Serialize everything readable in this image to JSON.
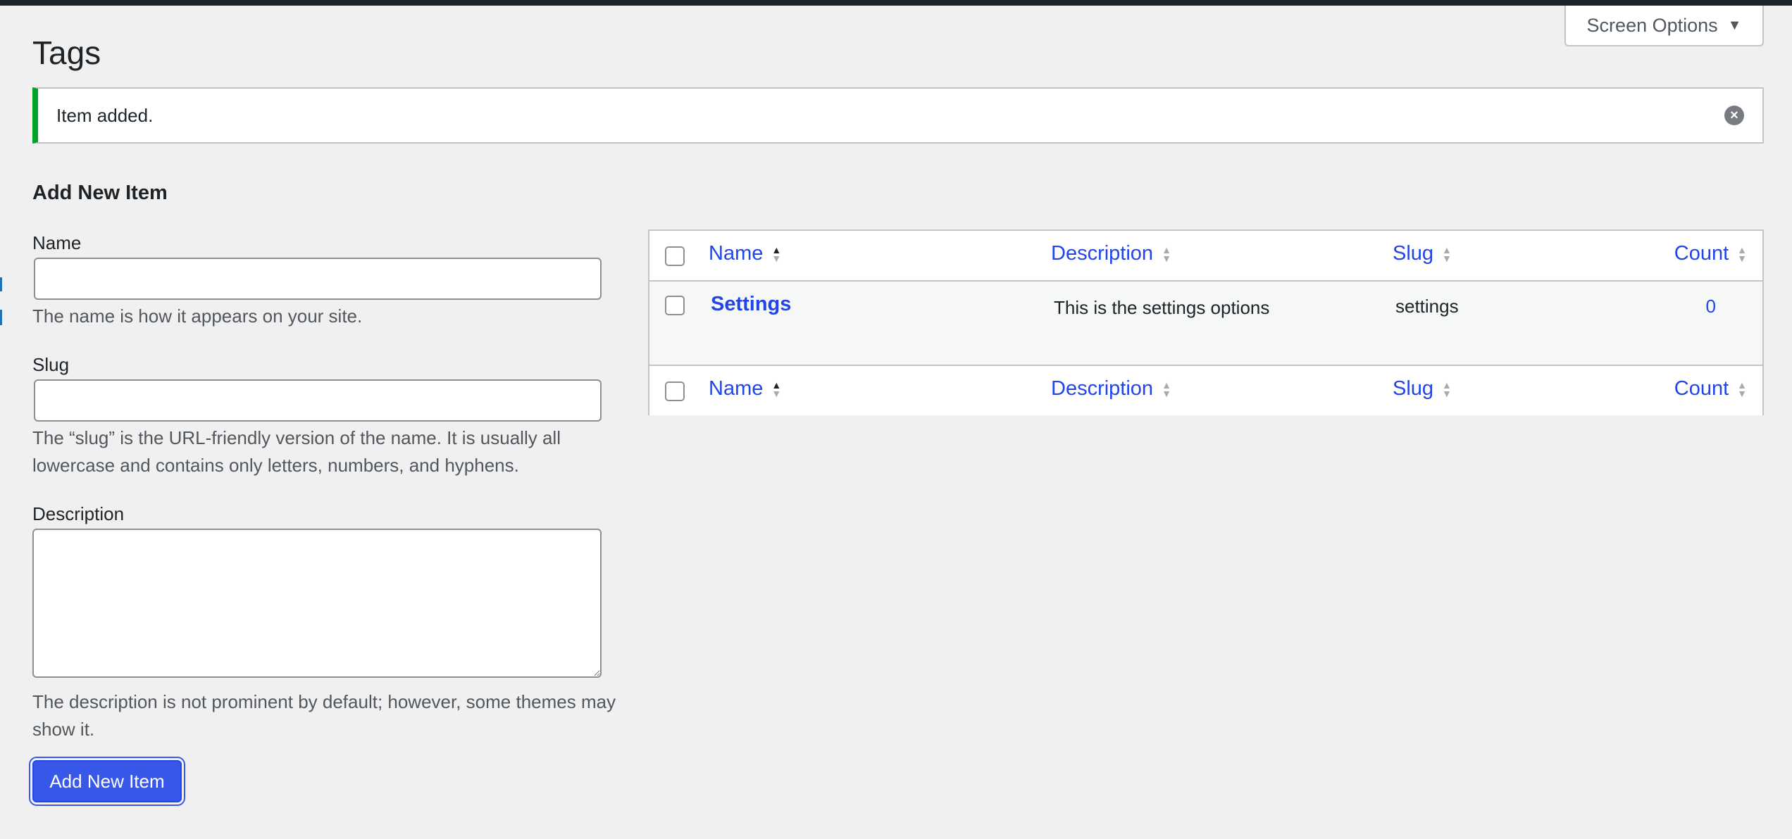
{
  "screen_options": {
    "label": "Screen Options"
  },
  "page": {
    "title": "Tags"
  },
  "notice": {
    "message": "Item added."
  },
  "form": {
    "heading": "Add New Item",
    "name": {
      "label": "Name",
      "value": "",
      "help": "The name is how it appears on your site."
    },
    "slug": {
      "label": "Slug",
      "value": "",
      "help": "The “slug” is the URL-friendly version of the name. It is usually all lowercase and contains only letters, numbers, and hyphens."
    },
    "description": {
      "label": "Description",
      "value": "",
      "help": "The description is not prominent by default; however, some themes may show it."
    },
    "submit_label": "Add New Item"
  },
  "table": {
    "columns": [
      "Name",
      "Description",
      "Slug",
      "Count"
    ],
    "sorted_column": "Name",
    "rows": [
      {
        "name": "Settings",
        "description": "This is the settings options",
        "slug": "settings",
        "count": "0"
      }
    ]
  },
  "colors": {
    "accent": "#3858e9",
    "link": "#2145e6",
    "success": "#00a32a"
  }
}
